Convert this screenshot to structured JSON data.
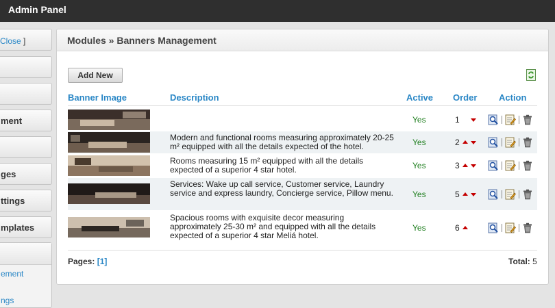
{
  "app": {
    "title": "Admin Panel"
  },
  "sidebar": {
    "close_link": "Close",
    "close_bracket": " ]",
    "items": [
      {
        "label": ""
      },
      {
        "label": ""
      },
      {
        "label": "ment"
      },
      {
        "label": ""
      },
      {
        "label": "ges"
      },
      {
        "label": "ttings"
      },
      {
        "label": "mplates"
      },
      {
        "label": ""
      }
    ],
    "sub_links": [
      {
        "label": "ement"
      },
      {
        "label": "ngs"
      }
    ]
  },
  "panel": {
    "title": "Modules » Banners Management"
  },
  "toolbar": {
    "add_new_label": "Add New",
    "refresh_icon": "refresh-icon"
  },
  "table": {
    "columns": [
      "Banner Image",
      "Description",
      "Active",
      "Order",
      "Action"
    ],
    "rows": [
      {
        "description": "",
        "active": "Yes",
        "order": "1",
        "up": false,
        "down": true,
        "thumb_colors": [
          "#3b2f2a",
          "#7a6a5c",
          "#c9b8a4"
        ]
      },
      {
        "description": "Modern and functional rooms measuring approximately 20-25 m² equipped with all the details expected of the hotel.",
        "active": "Yes",
        "order": "2",
        "up": true,
        "down": true,
        "thumb_colors": [
          "#2a2420",
          "#6e5d4e",
          "#bfae98"
        ]
      },
      {
        "description": "Rooms measuring 15 m² equipped with all the details expected of a superior 4 star hotel.",
        "active": "Yes",
        "order": "3",
        "up": true,
        "down": true,
        "thumb_colors": [
          "#4a3b2e",
          "#8c7560",
          "#d2c2ad"
        ]
      },
      {
        "description": "Services: Wake up call service, Customer service, Laundry service and express laundry, Concierge service, Pillow menu.",
        "active": "Yes",
        "order": "5",
        "up": true,
        "down": true,
        "thumb_colors": [
          "#201a18",
          "#5a4a40",
          "#a89886"
        ]
      },
      {
        "description": "Spacious rooms with exquisite decor measuring approximately 25-30 m² and equipped with all the details expected of a superior 4 star Meliá hotel.",
        "active": "Yes",
        "order": "6",
        "up": true,
        "down": false,
        "thumb_colors": [
          "#2c2622",
          "#75685c",
          "#cdbfae"
        ]
      }
    ],
    "action_icons": [
      "view-icon",
      "edit-icon",
      "delete-icon"
    ]
  },
  "footer": {
    "pages_label": "Pages:",
    "page_link": "[1]",
    "total_label": "Total:",
    "total_value": "5"
  },
  "colors": {
    "link": "#2a87c6",
    "active_yes": "#1e7e1e",
    "arrow": "#c40000",
    "topbar": "#2f2f2f"
  }
}
